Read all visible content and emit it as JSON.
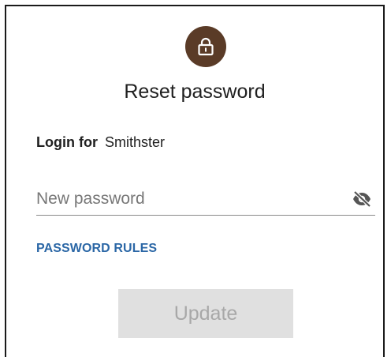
{
  "dialog": {
    "title": "Reset password",
    "icon": "lock-icon",
    "icon_bg_color": "#5a3b27"
  },
  "login": {
    "label": "Login for",
    "username": "Smithster"
  },
  "password_field": {
    "value": "",
    "placeholder": "New password",
    "toggle_icon": "eye-off-icon"
  },
  "rules_link": {
    "label": "PASSWORD RULES",
    "color": "#2b67a6"
  },
  "update_button": {
    "label": "Update",
    "state": "disabled"
  }
}
